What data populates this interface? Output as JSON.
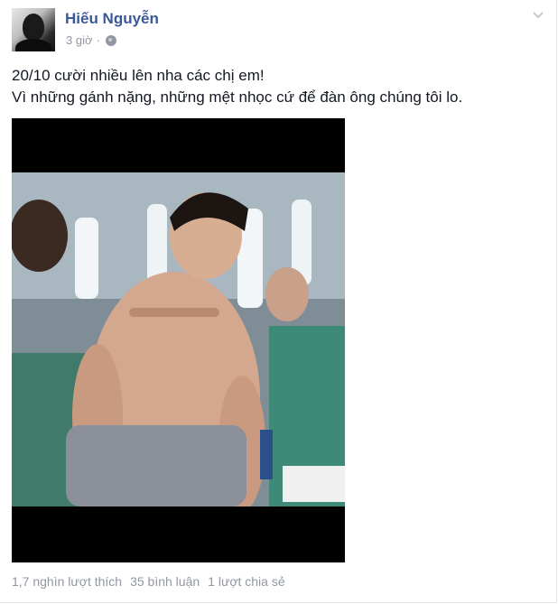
{
  "post": {
    "author": "Hiếu Nguyễn",
    "time": "3 giờ",
    "separator": "·",
    "privacy_icon": "globe-icon",
    "menu_icon": "chevron-down-icon",
    "text_lines": [
      "20/10 cười nhiều lên nha các chị em!",
      "Vì những gánh nặng, những mệt nhọc cứ để đàn ông chúng tôi lo."
    ]
  },
  "stats": {
    "likes": "1,7 nghìn lượt thích",
    "comments": "35 bình luận",
    "shares": "1 lượt chia sẻ"
  },
  "colors": {
    "author": "#3b5998",
    "meta": "#9197a3",
    "text": "#141823"
  }
}
